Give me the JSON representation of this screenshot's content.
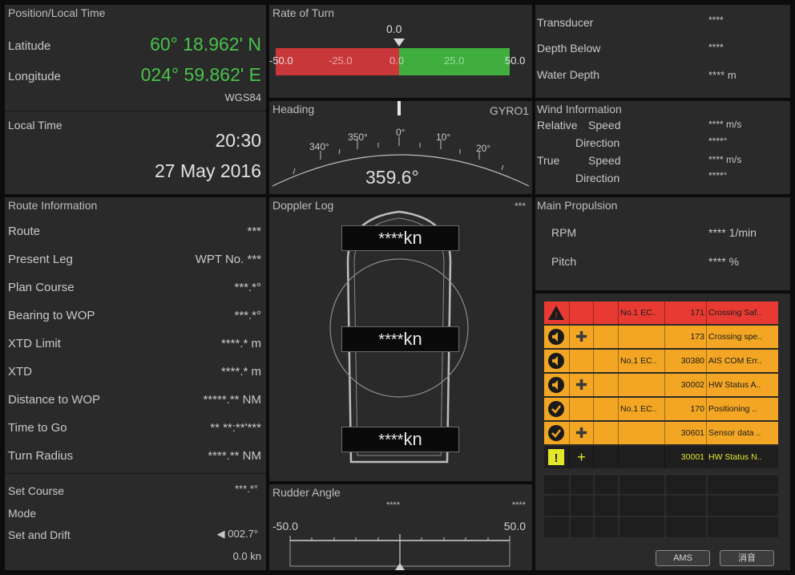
{
  "position": {
    "title": "Position/Local Time",
    "latitude_label": "Latitude",
    "latitude_value": "60° 18.962' N",
    "longitude_label": "Longitude",
    "longitude_value": "024° 59.862' E",
    "datum": "WGS84",
    "local_time_label": "Local Time",
    "time": "20:30",
    "date": "27 May 2016"
  },
  "rate_of_turn": {
    "title": "Rate of Turn",
    "value": "0.0",
    "scale": [
      "-50.0",
      "-25.0",
      "0.0",
      "25.0",
      "50.0"
    ],
    "colors": {
      "port": "#c8383a",
      "starboard": "#3fae3f"
    }
  },
  "heading": {
    "title": "Heading",
    "source": "GYRO1",
    "value": "359.6°",
    "ticks": [
      "340°",
      "350°",
      "0°",
      "10°",
      "20°"
    ]
  },
  "sounder": {
    "transducer_label": "Transducer",
    "transducer_value": "****",
    "depth_below_label": "Depth Below",
    "depth_below_value": "****",
    "water_depth_label": "Water Depth",
    "water_depth_value": "**** m"
  },
  "wind": {
    "title": "Wind Information",
    "relative_label": "Relative",
    "true_label": "True",
    "speed_label": "Speed",
    "direction_label": "Direction",
    "rel_speed": "**** m/s",
    "rel_dir": "****°",
    "true_speed": "**** m/s",
    "true_dir": "****°"
  },
  "route": {
    "title": "Route Information",
    "rows": [
      {
        "label": "Route",
        "value": "***"
      },
      {
        "label": "Present Leg",
        "value": "WPT No. ***"
      },
      {
        "label": "Plan Course",
        "value": "***.*°"
      },
      {
        "label": "Bearing to WOP",
        "value": "***.*°"
      },
      {
        "label": "XTD Limit",
        "value": "****.* m"
      },
      {
        "label": "XTD",
        "value": "****.* m"
      },
      {
        "label": "Distance to WOP",
        "value": "*****.** NM"
      },
      {
        "label": "Time to Go",
        "value": "** **:**'***"
      },
      {
        "label": "Turn Radius",
        "value": "****.** NM"
      }
    ],
    "set_course_label": "Set Course",
    "set_course_value": "***.*°",
    "mode_label": "Mode",
    "set_drift_label": "Set and Drift",
    "set_drift_dir": "◀ 002.7°",
    "set_drift_speed": "0.0 kn"
  },
  "doppler": {
    "title": "Doppler Log",
    "status": "***",
    "speeds": [
      "****",
      "****",
      "****"
    ],
    "unit": "kn"
  },
  "propulsion": {
    "title": "Main Propulsion",
    "rpm_label": "RPM",
    "rpm_value": "**** 1/min",
    "pitch_label": "Pitch",
    "pitch_value": "**** %"
  },
  "rudder": {
    "title": "Rudder Angle",
    "left_value": "****",
    "right_value": "****",
    "scale_left": "-50.0",
    "scale_right": "50.0"
  },
  "alarms": {
    "rows": [
      {
        "icon": "warning-triangle-icon",
        "ack": "",
        "source": "No.1 EC..",
        "id": "171",
        "text": "Crossing Saf..",
        "color": "#e83a32"
      },
      {
        "icon": "speaker-icon",
        "ack": "✚",
        "source": "",
        "id": "173",
        "text": "Crossing spe..",
        "color": "#f2a623"
      },
      {
        "icon": "speaker-icon",
        "ack": "",
        "source": "No.1 EC..",
        "id": "30380",
        "text": "AIS COM Err..",
        "color": "#f2a623"
      },
      {
        "icon": "speaker-icon",
        "ack": "✚",
        "source": "",
        "id": "30002",
        "text": "HW Status A..",
        "color": "#f2a623"
      },
      {
        "icon": "check-icon",
        "ack": "",
        "source": "No.1 EC..",
        "id": "170",
        "text": "Positioning ..",
        "color": "#f2a623"
      },
      {
        "icon": "check-icon",
        "ack": "✚",
        "source": "",
        "id": "30601",
        "text": "Sensor data ..",
        "color": "#f2a623"
      },
      {
        "icon": "exclamation-icon",
        "ack": "+",
        "source": "",
        "id": "30001",
        "text": "HW Status N..",
        "color": "#1e1e1e"
      }
    ],
    "ams_label": "AMS",
    "clear_label": "消音"
  }
}
